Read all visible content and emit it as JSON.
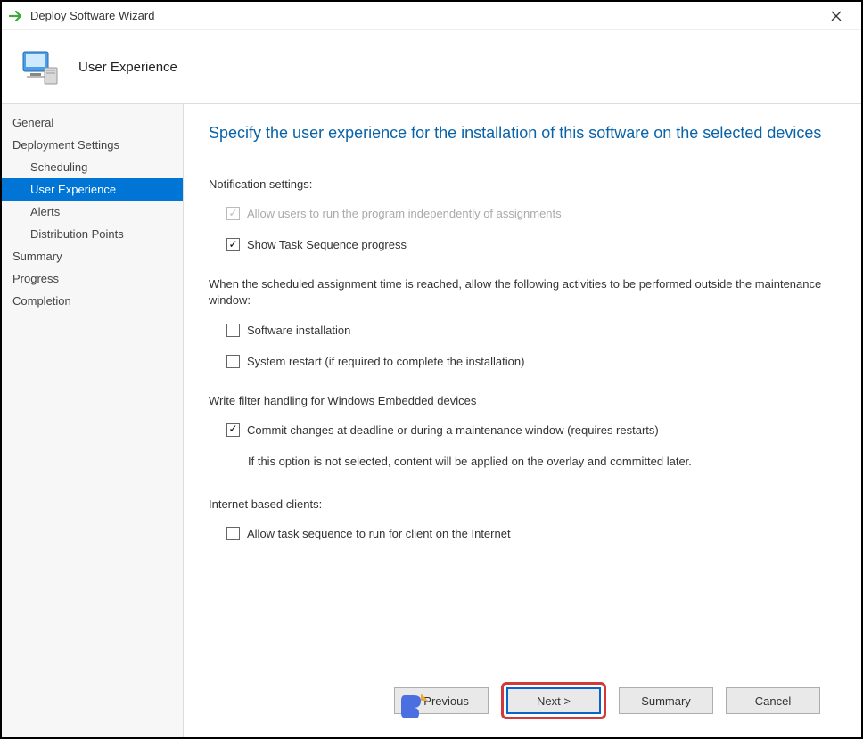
{
  "window": {
    "title": "Deploy Software Wizard"
  },
  "header": {
    "step_title": "User Experience"
  },
  "sidebar": {
    "items": [
      {
        "label": "General",
        "sub": false,
        "selected": false
      },
      {
        "label": "Deployment Settings",
        "sub": false,
        "selected": false
      },
      {
        "label": "Scheduling",
        "sub": true,
        "selected": false
      },
      {
        "label": "User Experience",
        "sub": true,
        "selected": true
      },
      {
        "label": "Alerts",
        "sub": true,
        "selected": false
      },
      {
        "label": "Distribution Points",
        "sub": true,
        "selected": false
      },
      {
        "label": "Summary",
        "sub": false,
        "selected": false
      },
      {
        "label": "Progress",
        "sub": false,
        "selected": false
      },
      {
        "label": "Completion",
        "sub": false,
        "selected": false
      }
    ]
  },
  "main": {
    "heading": "Specify the user experience for the installation of this software on the selected devices",
    "notification_label": "Notification settings:",
    "cb_allow_independent": "Allow users to run the program independently of assignments",
    "cb_show_progress": "Show Task Sequence progress",
    "maintenance_text": "When the scheduled assignment time is reached, allow the following activities to be performed outside the maintenance window:",
    "cb_software_install": "Software installation",
    "cb_system_restart": "System restart (if required to complete the installation)",
    "write_filter_label": "Write filter handling for Windows Embedded devices",
    "cb_commit": "Commit changes at deadline or during a maintenance window (requires restarts)",
    "commit_note": "If this option is not selected, content will be applied on the overlay and committed later.",
    "internet_label": "Internet based clients:",
    "cb_internet": "Allow task sequence to run for client on the Internet"
  },
  "footer": {
    "previous": "< Previous",
    "next": "Next >",
    "summary": "Summary",
    "cancel": "Cancel"
  }
}
